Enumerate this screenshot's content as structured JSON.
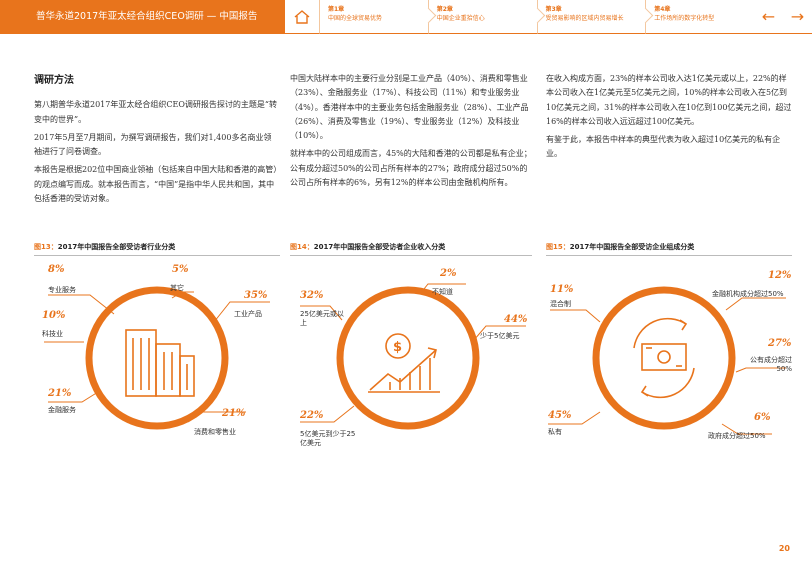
{
  "header": {
    "title": "普华永道2017年亚太经合组织CEO调研 — 中国报告",
    "chapters": [
      {
        "no": "第1章",
        "name": "中国的全球贸易优势"
      },
      {
        "no": "第2章",
        "name": "中国企业重拾信心"
      },
      {
        "no": "第3章",
        "name": "受贸易影响的区域内贸易增长"
      },
      {
        "no": "第4章",
        "name": "工作场所的数字化转型"
      }
    ],
    "nav_prev": "←",
    "nav_next": "→"
  },
  "col1": {
    "heading": "调研方法",
    "p1": "第八期普华永道2017年亚太经合组织CEO调研报告探讨的主题是“转变中的世界”。",
    "p2": "2017年5月至7月期间，为撰写调研报告，我们对1,400多名商业领袖进行了问卷调查。",
    "p3": "本报告是根据202位中国商业领袖（包括来自中国大陆和香港的高管）的观点编写而成。就本报告而言，“中国”是指中华人民共和国，其中包括香港的受访对象。"
  },
  "col2": {
    "p1": "中国大陆样本中的主要行业分别是工业产品（40%）、消费和零售业（23%）、金融服务业（17%）、科技公司（11%）和专业服务业（4%）。香港样本中的主要业务包括金融服务业（28%）、工业产品（26%）、消费及零售业（19%）、专业服务业（12%）及科技业（10%）。",
    "p2": "就样本中的公司组成而言，45%的大陆和香港的公司都是私有企业；公有成分超过50%的公司占所有样本的27%；政府成分超过50%的公司占所有样本的6%，另有12%的样本公司由金融机构所有。"
  },
  "col3": {
    "p1": "在收入构成方面，23%的样本公司收入达1亿美元或以上，22%的样本公司收入在1亿美元至5亿美元之间，10%的样本公司收入在5亿到10亿美元之间，31%的样本公司收入在10亿到100亿美元之间，超过16%的样本公司收入远远超过100亿美元。",
    "p2": "有鉴于此，本报告中样本的典型代表为收入超过10亿美元的私有企业。"
  },
  "charts": {
    "c1": {
      "fig": "图13：",
      "title": "2017年中国报告全部受访者行业分类",
      "items": [
        {
          "pct": "8%",
          "label": "专业服务"
        },
        {
          "pct": "5%",
          "label": "其它"
        },
        {
          "pct": "35%",
          "label": "工业产品"
        },
        {
          "pct": "10%",
          "label": "科技业"
        },
        {
          "pct": "21%",
          "label": "金融服务"
        },
        {
          "pct": "21%",
          "label": "消费和零售业"
        }
      ]
    },
    "c2": {
      "fig": "图14：",
      "title": "2017年中国报告全部受访者企业收入分类",
      "items": [
        {
          "pct": "2%",
          "label": "不知道"
        },
        {
          "pct": "32%",
          "label": "25亿美元或以上"
        },
        {
          "pct": "44%",
          "label": "少于5亿美元"
        },
        {
          "pct": "22%",
          "label": "5亿美元到少于25亿美元"
        }
      ]
    },
    "c3": {
      "fig": "图15：",
      "title": "2017年中国报告全部受访企业组成分类",
      "items": [
        {
          "pct": "11%",
          "label": "混合制"
        },
        {
          "pct": "12%",
          "label": "金融机构成分超过50%"
        },
        {
          "pct": "27%",
          "label": "公有成分超过50%"
        },
        {
          "pct": "45%",
          "label": "私有"
        },
        {
          "pct": "6%",
          "label": "政府成分超过50%"
        }
      ]
    }
  },
  "chart_data": [
    {
      "type": "pie",
      "title": "2017年中国报告全部受访者行业分类",
      "categories": [
        "专业服务",
        "其它",
        "工业产品",
        "消费和零售业",
        "金融服务",
        "科技业"
      ],
      "values": [
        8,
        5,
        35,
        21,
        21,
        10
      ]
    },
    {
      "type": "pie",
      "title": "2017年中国报告全部受访者企业收入分类",
      "categories": [
        "不知道",
        "少于5亿美元",
        "5亿美元到少于25亿美元",
        "25亿美元或以上"
      ],
      "values": [
        2,
        44,
        22,
        32
      ]
    },
    {
      "type": "pie",
      "title": "2017年中国报告全部受访企业组成分类",
      "categories": [
        "金融机构成分超过50%",
        "公有成分超过50%",
        "政府成分超过50%",
        "私有",
        "混合制"
      ],
      "values": [
        12,
        27,
        6,
        45,
        11
      ]
    }
  ],
  "colors": {
    "accent": "#e8741c"
  },
  "page_number": "20"
}
